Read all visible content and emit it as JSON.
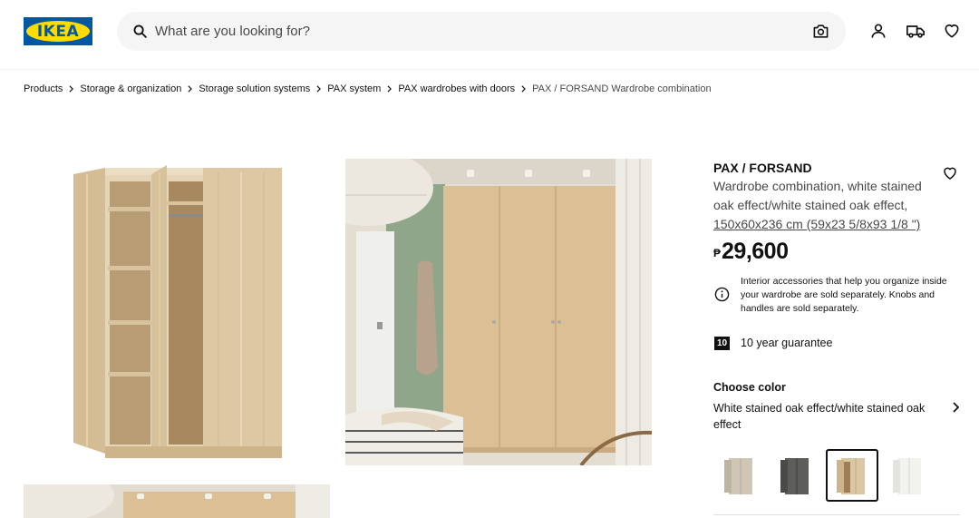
{
  "header": {
    "logo_text": "IKEA",
    "search_placeholder": "What are you looking for?",
    "icons": [
      "search-icon",
      "camera-icon",
      "user-icon",
      "truck-icon",
      "heart-icon"
    ]
  },
  "breadcrumb": [
    "Products",
    "Storage & organization",
    "Storage solution systems",
    "PAX system",
    "PAX wardrobes with doors",
    "PAX / FORSAND Wardrobe combination"
  ],
  "product": {
    "name": "PAX / FORSAND",
    "description": "Wardrobe combination, white stained oak effect/white stained oak effect,",
    "size": "150x60x236 cm (59x23 5/8x93 1/8 \")",
    "currency": "₱",
    "price": "29,600",
    "notice": "Interior accessories that help you organize inside your wardrobe are sold separately. Knobs and handles are sold separately.",
    "guarantee_badge": "10",
    "guarantee_text": "10 year guarantee"
  },
  "color": {
    "title": "Choose color",
    "selected": "White stained oak effect/white stained oak effect",
    "swatches": [
      "light grey-beige",
      "dark grey",
      "white stained oak",
      "white"
    ]
  },
  "colors": {
    "brand_blue": "#0058a3",
    "brand_yellow": "#ffdb00",
    "wood": "#dcc7a4",
    "wall_green": "#8fa68a"
  }
}
